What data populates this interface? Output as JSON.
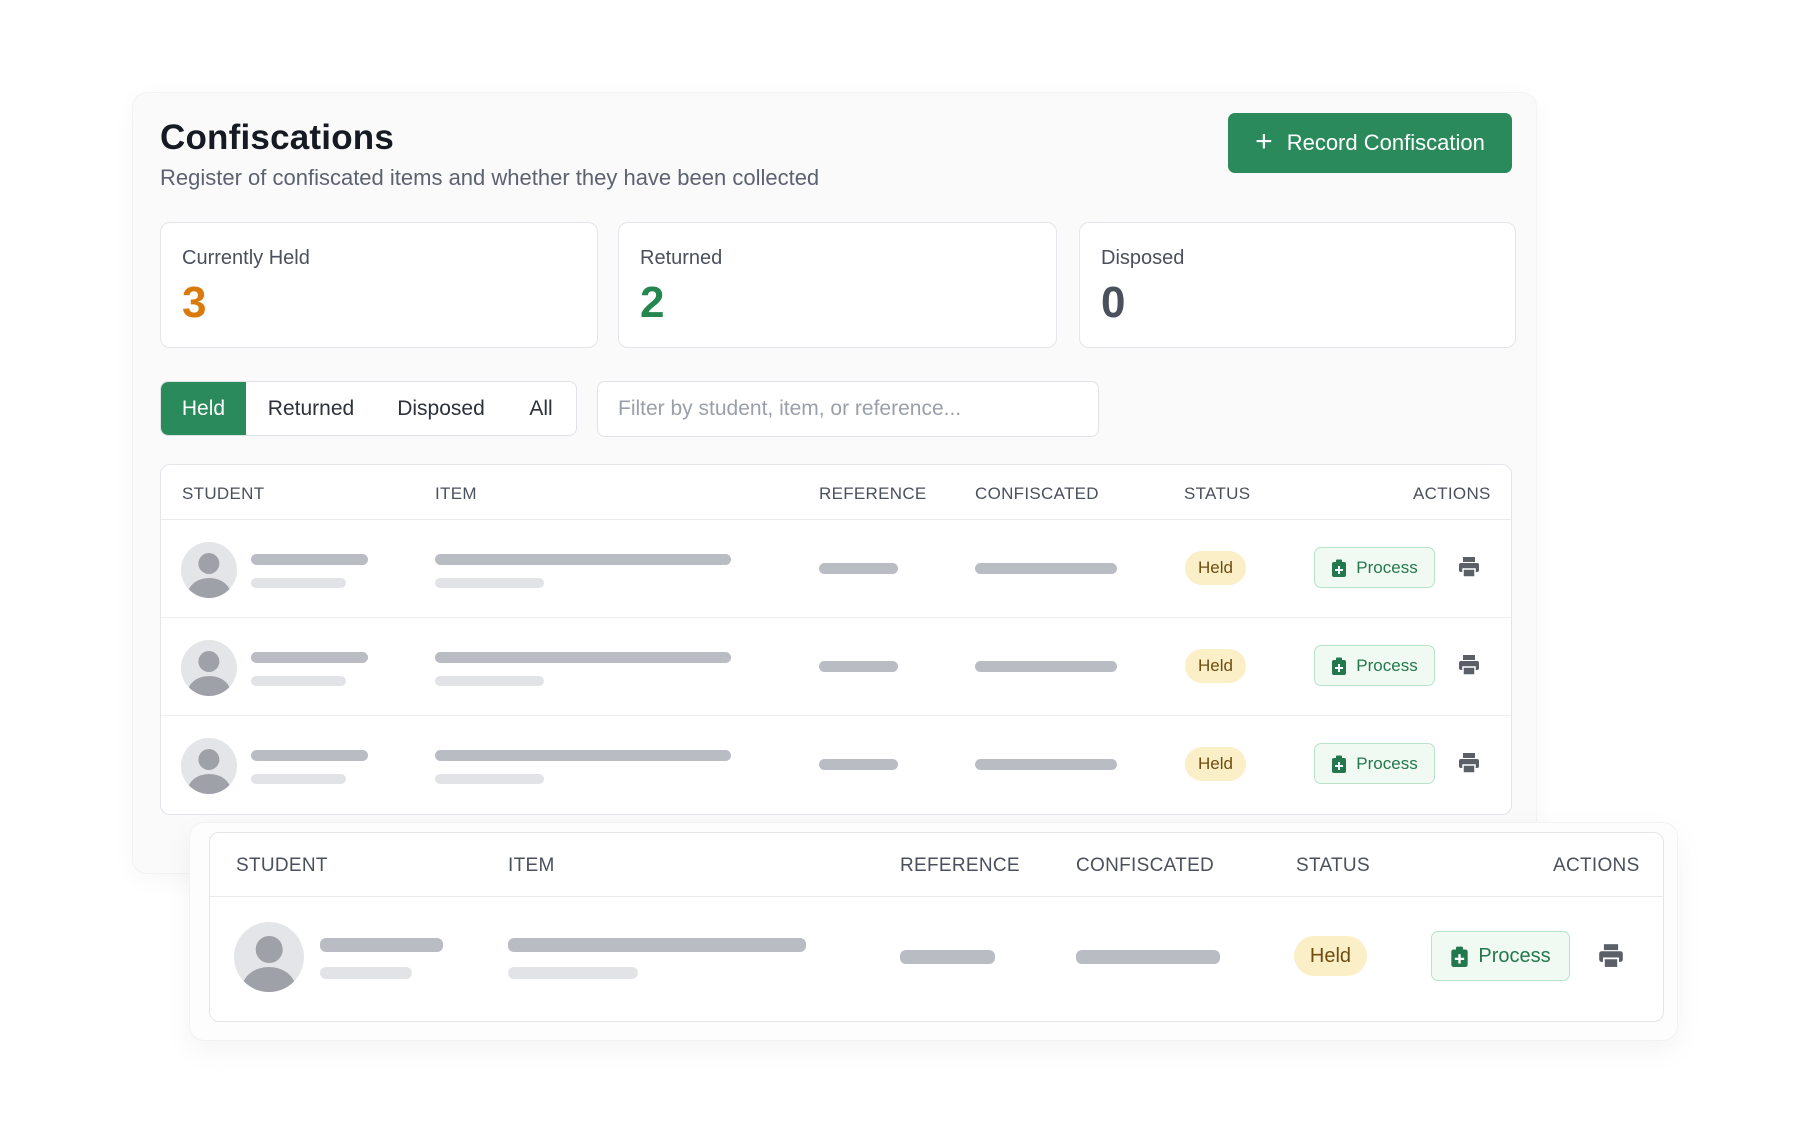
{
  "header": {
    "title": "Confiscations",
    "subtitle": "Register of confiscated items and whether they have been collected",
    "record_button_label": "Record Confiscation",
    "record_button_icon": "plus-icon"
  },
  "stats": [
    {
      "label": "Currently Held",
      "value": "3",
      "color": "#d97a0c"
    },
    {
      "label": "Returned",
      "value": "2",
      "color": "#23874f"
    },
    {
      "label": "Disposed",
      "value": "0",
      "color": "#4a505c"
    }
  ],
  "tabs": [
    {
      "label": "Held",
      "active": true
    },
    {
      "label": "Returned",
      "active": false
    },
    {
      "label": "Disposed",
      "active": false
    },
    {
      "label": "All",
      "active": false
    }
  ],
  "filter": {
    "placeholder": "Filter by student, item, or reference...",
    "value": ""
  },
  "table": {
    "columns": [
      "STUDENT",
      "ITEM",
      "REFERENCE",
      "CONFISCATED",
      "STATUS",
      "ACTIONS"
    ],
    "rows": [
      {
        "status": "Held",
        "action_label": "Process"
      },
      {
        "status": "Held",
        "action_label": "Process"
      },
      {
        "status": "Held",
        "action_label": "Process"
      }
    ]
  },
  "zoom": {
    "columns": [
      "STUDENT",
      "ITEM",
      "REFERENCE",
      "CONFISCATED",
      "STATUS",
      "ACTIONS"
    ],
    "row": {
      "status": "Held",
      "action_label": "Process"
    }
  },
  "colors": {
    "accent": "#2b8a5c",
    "badge_bg": "#fbefc8",
    "badge_text": "#6f4d10",
    "process_bg": "#f0faf3",
    "process_text": "#23774d"
  },
  "icons": {
    "process": "clipboard-plus-icon",
    "print": "printer-icon",
    "avatar": "user-avatar-icon"
  }
}
